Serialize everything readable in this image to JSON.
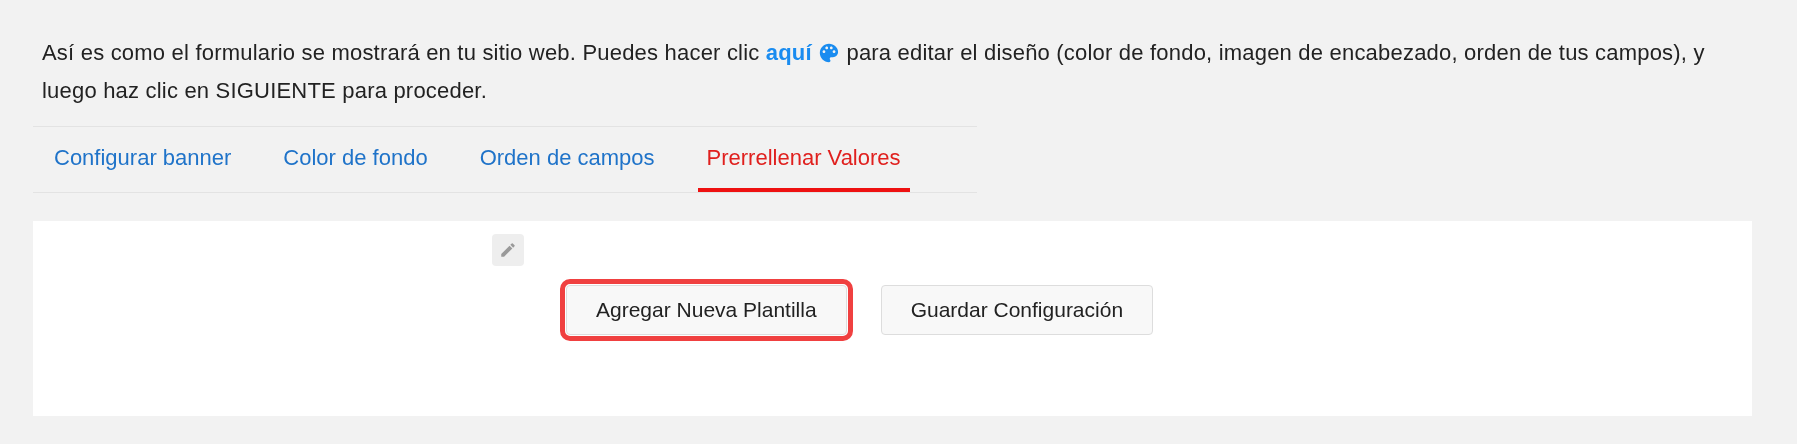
{
  "intro": {
    "before": "Así es como el formulario se mostrará en tu sitio web. Puedes hacer clic",
    "link": "aquí",
    "after": "para editar el diseño (color de fondo, imagen de encabezado, orden de tus campos), y luego haz clic en SIGUIENTE para proceder."
  },
  "tabs": [
    {
      "label": "Configurar banner",
      "selected": false
    },
    {
      "label": "Color de fondo",
      "selected": false
    },
    {
      "label": "Orden de campos",
      "selected": false
    },
    {
      "label": "Prerrellenar Valores",
      "selected": true
    }
  ],
  "buttons": [
    {
      "label": "Agregar Nueva Plantilla",
      "highlighted": true
    },
    {
      "label": "Guardar Configuración",
      "highlighted": false
    }
  ]
}
